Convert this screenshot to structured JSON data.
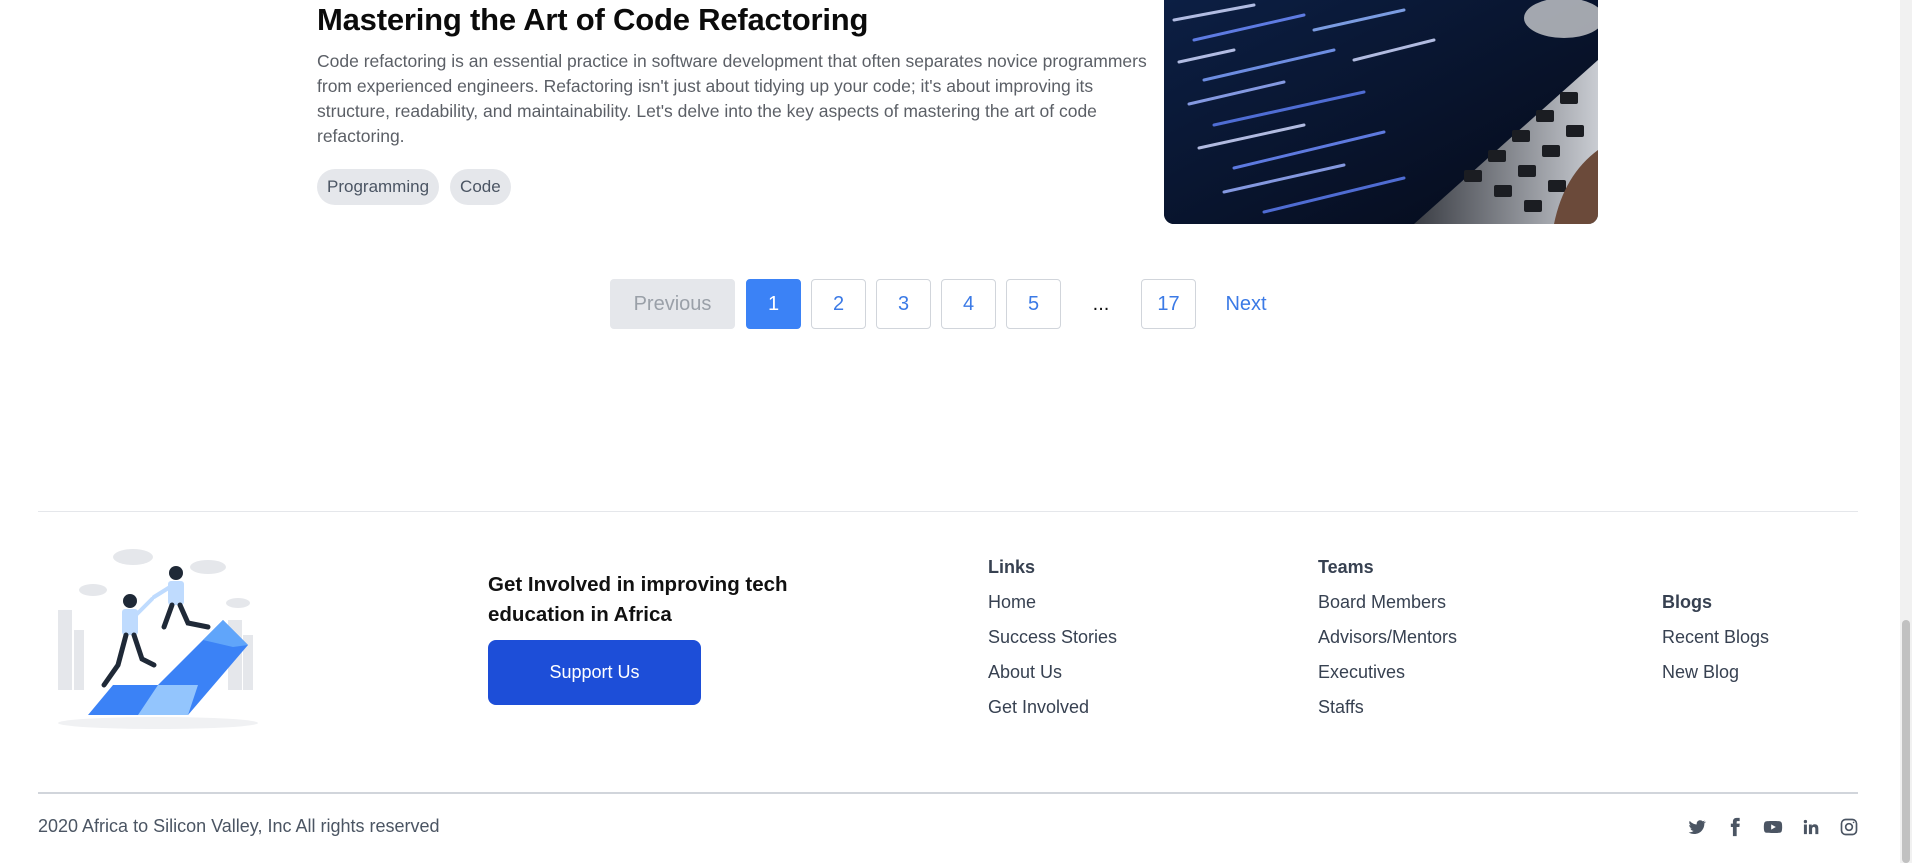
{
  "post": {
    "title": "Mastering the Art of Code Refactoring",
    "excerpt": "Code refactoring is an essential practice in software development that often separates novice programmers from experienced engineers. Refactoring isn't just about tidying up your code; it's about improving its structure, readability, and maintainability. Let's delve into the key aspects of mastering the art of code refactoring.",
    "tags": [
      "Programming",
      "Code"
    ]
  },
  "pagination": {
    "previous": "Previous",
    "pages": [
      "1",
      "2",
      "3",
      "4",
      "5"
    ],
    "ellipsis": "...",
    "last": "17",
    "next": "Next",
    "current": "1"
  },
  "footer": {
    "cta_heading": "Get Involved in improving tech education in Africa",
    "support_button": "Support Us",
    "links": {
      "heading": "Links",
      "items": [
        "Home",
        "Success Stories",
        "About Us",
        "Get Involved"
      ]
    },
    "teams": {
      "heading": "Teams",
      "items": [
        "Board Members",
        "Advisors/Mentors",
        "Executives",
        "Staffs"
      ]
    },
    "blogs": {
      "heading": "Blogs",
      "items": [
        "Recent Blogs",
        "New Blog"
      ]
    },
    "copyright": "2020 Africa to Silicon Valley, Inc All rights reserved",
    "socials": [
      "twitter-icon",
      "facebook-icon",
      "youtube-icon",
      "linkedin-icon",
      "instagram-icon"
    ]
  },
  "colors": {
    "accent": "#3b82f6",
    "button": "#1d4ed8"
  }
}
